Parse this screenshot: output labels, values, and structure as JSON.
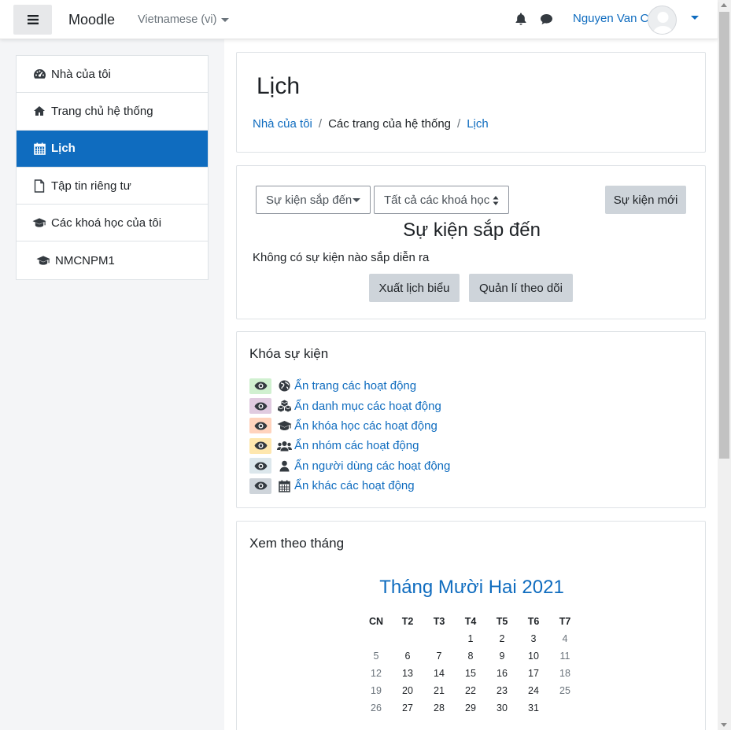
{
  "navbar": {
    "brand": "Moodle",
    "language": "Vietnamese (vi)",
    "user_name": "Nguyen Van C"
  },
  "drawer": {
    "items": [
      {
        "label": "Nhà của tôi",
        "icon": "dashboard-icon",
        "active": false
      },
      {
        "label": "Trang chủ hệ thống",
        "icon": "home-icon",
        "active": false
      },
      {
        "label": "Lịch",
        "icon": "calendar-icon",
        "active": true
      },
      {
        "label": "Tập tin riêng tư",
        "icon": "file-icon",
        "active": false
      },
      {
        "label": "Các khoá học của tôi",
        "icon": "graduation-cap-icon",
        "active": false
      },
      {
        "label": "NMCNPM1",
        "icon": "graduation-cap-icon",
        "active": false
      }
    ]
  },
  "header": {
    "title": "Lịch",
    "breadcrumb": [
      "Nhà của tôi",
      "Các trang của hệ thống",
      "Lịch"
    ]
  },
  "upcoming": {
    "view_select": "Sự kiện sắp đến",
    "course_select": "Tất cả các khoá học",
    "new_event_label": "Sự kiện mới",
    "title": "Sự kiện sắp đến",
    "empty_message": "Không có sự kiện nào sắp diễn ra",
    "export_label": "Xuất lịch biểu",
    "manage_label": "Quản lí theo dõi"
  },
  "event_key": {
    "title": "Khóa sự kiện",
    "filters": [
      {
        "label": "Ẩn trang các hoạt động",
        "icon": "globe-icon",
        "color": "#d0f0d0"
      },
      {
        "label": "Ẩn danh mục các hoạt động",
        "icon": "cubes-icon",
        "color": "#e0cbe0"
      },
      {
        "label": "Ẩn khóa học các hoạt động",
        "icon": "graduation-cap-icon",
        "color": "#ffd3bd"
      },
      {
        "label": "Ẩn nhóm các hoạt động",
        "icon": "users-icon",
        "color": "#fee7ae"
      },
      {
        "label": "Ẩn người dùng các hoạt động",
        "icon": "user-icon",
        "color": "#dce7ec"
      },
      {
        "label": "Ẩn khác các hoạt động",
        "icon": "calendar-icon",
        "color": "#ced4da"
      }
    ]
  },
  "month_view": {
    "title": "Xem theo tháng",
    "month": "Tháng Mười Hai 2021",
    "weekdays": [
      "CN",
      "T2",
      "T3",
      "T4",
      "T5",
      "T6",
      "T7"
    ],
    "weeks": [
      [
        "",
        "",
        "",
        "1",
        "2",
        "3",
        "4"
      ],
      [
        "5",
        "6",
        "7",
        "8",
        "9",
        "10",
        "11"
      ],
      [
        "12",
        "13",
        "14",
        "15",
        "16",
        "17",
        "18"
      ],
      [
        "19",
        "20",
        "21",
        "22",
        "23",
        "24",
        "25"
      ],
      [
        "26",
        "27",
        "28",
        "29",
        "30",
        "31",
        ""
      ]
    ]
  }
}
